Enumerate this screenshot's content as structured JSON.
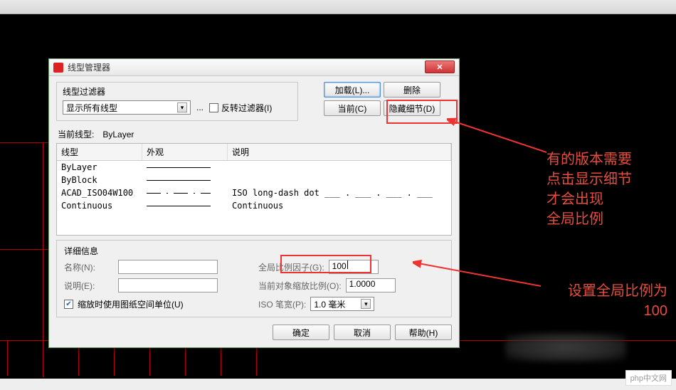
{
  "dialog": {
    "title": "线型管理器",
    "filter": {
      "legend": "线型过滤器",
      "combo": "显示所有线型",
      "invert": "反转过滤器(I)"
    },
    "buttons": {
      "load": "加载(L)...",
      "delete": "删除",
      "current": "当前(C)",
      "hide_detail": "隐藏细节(D)"
    },
    "current_label": "当前线型:",
    "current_value": "ByLayer",
    "list_headers": {
      "linetype": "线型",
      "appearance": "外观",
      "desc": "说明"
    },
    "rows": [
      {
        "name": "ByLayer",
        "appearance": "solid",
        "desc": ""
      },
      {
        "name": "ByBlock",
        "appearance": "solid",
        "desc": ""
      },
      {
        "name": "ACAD_ISO04W100",
        "appearance": "dashed",
        "desc": "ISO long-dash dot ___ . ___ . ___ . ___"
      },
      {
        "name": "Continuous",
        "appearance": "solid",
        "desc": "Continuous"
      }
    ],
    "details": {
      "legend": "详细信息",
      "name_label": "名称(N):",
      "desc_label": "说明(E):",
      "global_label": "全局比例因子(G):",
      "global_value": "100",
      "obj_scale_label": "当前对象缩放比例(O):",
      "obj_scale_value": "1.0000",
      "use_paper_label": "缩放时使用图纸空间单位(U)",
      "iso_pen_label": "ISO 笔宽(P):",
      "iso_pen_value": "1.0 毫米"
    },
    "bottom": {
      "ok": "确定",
      "cancel": "取消",
      "help": "帮助(H)"
    }
  },
  "annotations": {
    "top": "有的版本需要\n点击显示细节\n才会出现\n全局比例",
    "bottom": "设置全局比例为\n100"
  },
  "watermark": "php中文网"
}
